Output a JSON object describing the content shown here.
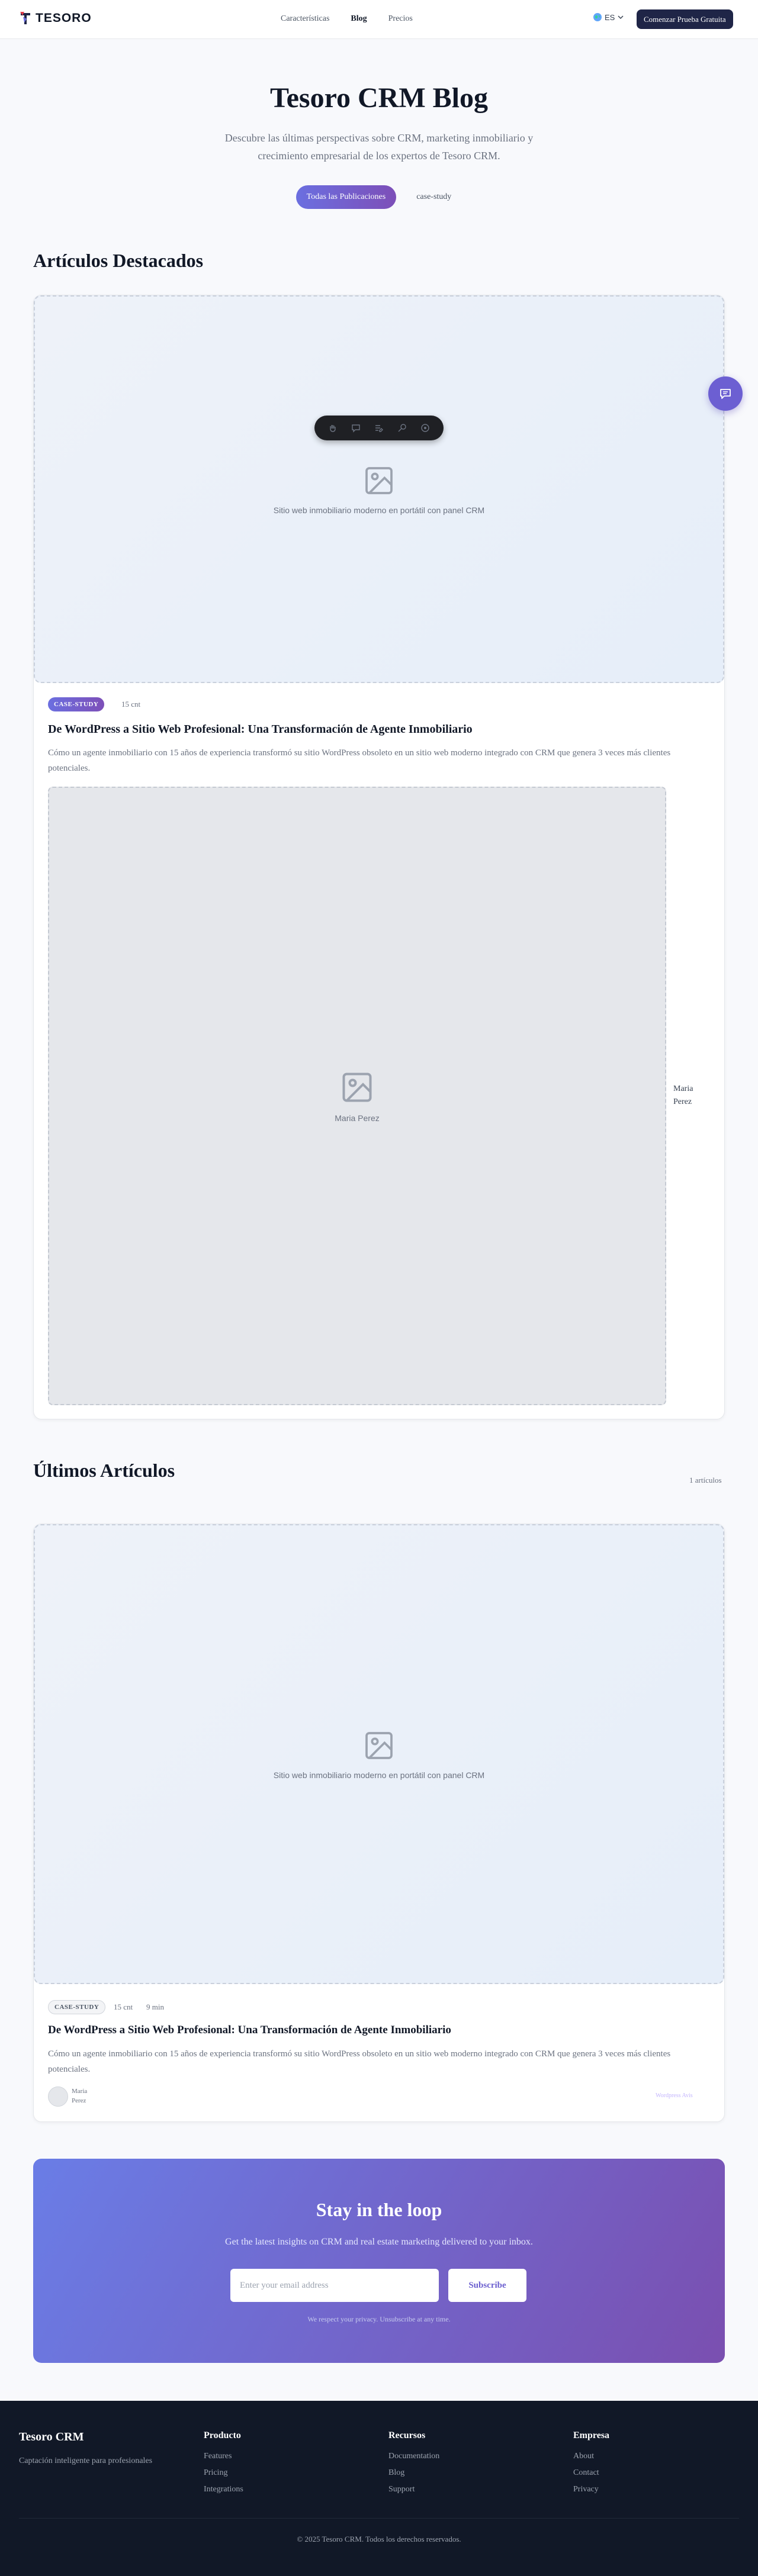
{
  "header": {
    "logo_text": "TESORO",
    "nav": [
      {
        "label": "Características"
      },
      {
        "label": "Blog"
      },
      {
        "label": "Precios"
      }
    ],
    "lang": "ES",
    "cta": "Comenzar Prueba Gratuita"
  },
  "hero": {
    "title": "Tesoro CRM Blog",
    "subtitle": "Descubre las últimas perspectivas sobre CRM, marketing inmobiliario y crecimiento empresarial de los expertos de Tesoro CRM.",
    "filter_all": "Todas las Publicaciones",
    "filter_tag": "case-study"
  },
  "featured": {
    "section_title": "Artículos Destacados",
    "image_caption": "Sitio web inmobiliario moderno en portátil con panel CRM",
    "tag": "CASE-STUDY",
    "read_time": "15 cnt",
    "title": "De WordPress a Sitio Web Profesional: Una Transformación de Agente Inmobiliario",
    "excerpt": "Cómo un agente inmobiliario con 15 años de experiencia transformó su sitio WordPress obsoleto en un sitio web moderno integrado con CRM que genera 3 veces más clientes potenciales.",
    "author_image_caption": "Maria Perez",
    "author_name": "Maria Perez"
  },
  "latest": {
    "section_title": "Últimos Artículos",
    "count": "1 artículos",
    "image_caption": "Sitio web inmobiliario moderno en portátil con panel CRM",
    "tag": "CASE-STUDY",
    "read_time": "15 cnt",
    "minutes": "9 min",
    "title": "De WordPress a Sitio Web Profesional: Una Transformación de Agente Inmobiliario",
    "excerpt": "Cómo un agente inmobiliario con 15 años de experiencia transformó su sitio WordPress obsoleto en un sitio web moderno integrado con CRM que genera 3 veces más clientes potenciales.",
    "author_name": "Maria Perez",
    "category": "Wordpress Avis"
  },
  "newsletter": {
    "title": "Stay in the loop",
    "subtitle": "Get the latest insights on CRM and real estate marketing delivered to your inbox.",
    "placeholder": "Enter your email address",
    "button": "Subscribe",
    "privacy": "We respect your privacy. Unsubscribe at any time."
  },
  "footer": {
    "brand": "Tesoro CRM",
    "tagline": "Captación inteligente para profesionales",
    "columns": [
      {
        "title": "Producto",
        "links": [
          "Features",
          "Pricing",
          "Integrations"
        ]
      },
      {
        "title": "Recursos",
        "links": [
          "Documentation",
          "Blog",
          "Support"
        ]
      },
      {
        "title": "Empresa",
        "links": [
          "About",
          "Contact",
          "Privacy"
        ]
      }
    ],
    "copyright": "© 2025 Tesoro CRM. Todos los derechos reservados."
  },
  "colors": {
    "accent_start": "#6b6fe0",
    "accent_end": "#7d4fb8",
    "dark": "#1f2547",
    "footer_bg": "#111827"
  }
}
